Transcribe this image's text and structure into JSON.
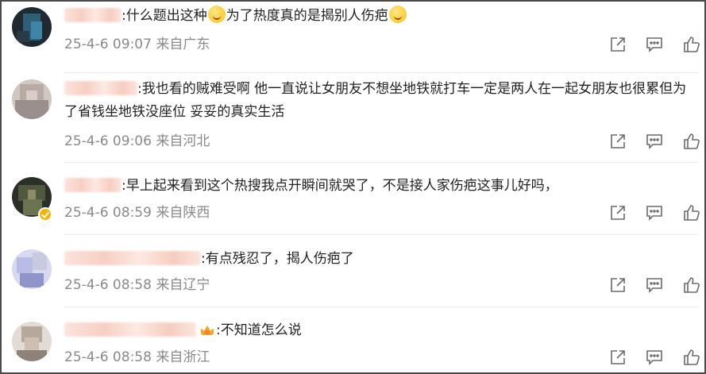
{
  "comments": [
    {
      "text": ":什么题出这种",
      "text_after_emoji": "为了热度真的是揭别人伤疤",
      "date": "25-4-6 09:07",
      "source": "来自广东"
    },
    {
      "text": ":我也看的贼难受啊 他一直说让女朋友不想坐地铁就打车一定是两人在一起女朋友也很累但为了省钱坐地铁没座位 妥妥的真实生活",
      "date": "25-4-6 09:06",
      "source": "来自河北"
    },
    {
      "text": ":早上起来看到这个热搜我点开瞬间就哭了，不是接人家伤疤这事儿好吗，",
      "date": "25-4-6 08:59",
      "source": "来自陕西"
    },
    {
      "text": ":有点残忍了，揭人伤疤了",
      "date": "25-4-6 08:58",
      "source": "来自辽宁"
    },
    {
      "text": ":不知道怎么说",
      "date": "25-4-6 08:58",
      "source": "来自浙江"
    }
  ],
  "icons": {
    "share": "share-icon",
    "reply": "comment-icon",
    "like": "thumbs-up-icon",
    "emoji": "emoji-icon",
    "badge": "crown-icon"
  },
  "colors": {
    "text": "#222222",
    "meta": "#8a8a8a",
    "icon": "#6b6b6b",
    "verified": "#f5b400"
  }
}
